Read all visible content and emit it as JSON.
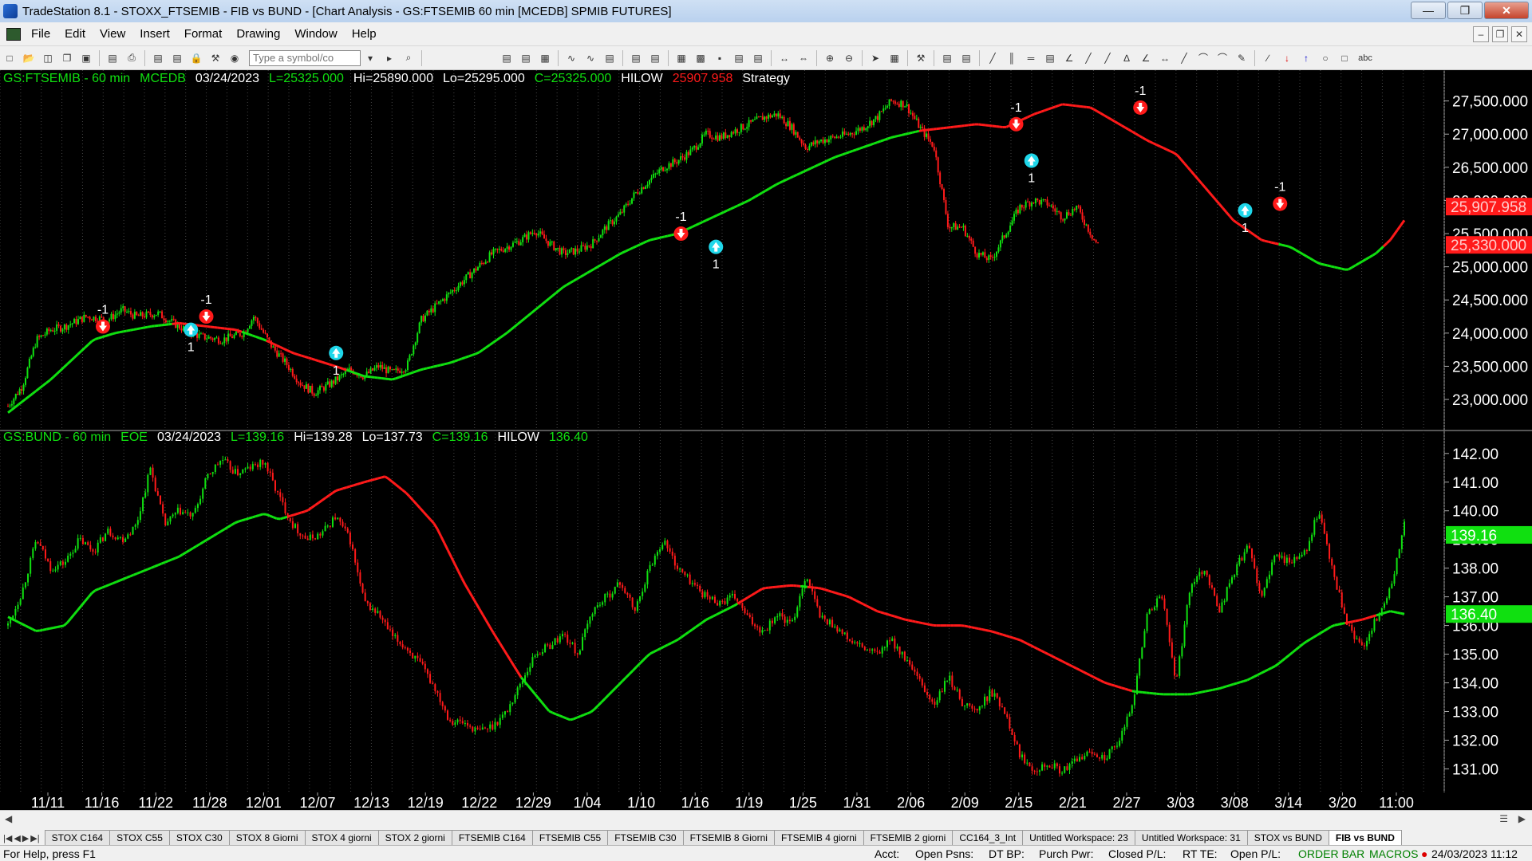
{
  "window": {
    "title": "TradeStation 8.1 - STOXX_FTSEMIB - FIB vs BUND - [Chart Analysis - GS:FTSEMIB  60 min  [MCEDB] SPMIB FUTURES]"
  },
  "menu": [
    "File",
    "Edit",
    "View",
    "Insert",
    "Format",
    "Drawing",
    "Window",
    "Help"
  ],
  "toolbar": {
    "symbol_placeholder": "Type a symbol/co"
  },
  "chart_data": [
    {
      "type": "candlestick",
      "header": {
        "symbol": "GS:FTSEMIB - 60 min",
        "source": "MCEDB",
        "date": "03/24/2023",
        "last": "L=25325.000",
        "high": "Hi=25890.000",
        "low": "Lo=25295.000",
        "close": "C=25325.000",
        "indicator": "HILOW",
        "indicator_value": "25907.958",
        "strategy": "Strategy"
      },
      "ylim": [
        22700,
        27700
      ],
      "y_ticks": [
        "27,500.000",
        "27,000.000",
        "26,500.000",
        "26,000.000",
        "25,500.000",
        "25,000.000",
        "24,500.000",
        "24,000.000",
        "23,500.000",
        "23,000.000"
      ],
      "y_tick_values": [
        27500,
        27000,
        26500,
        26000,
        25500,
        25000,
        24500,
        24000,
        23500,
        23000
      ],
      "price_markers": [
        {
          "label": "25,907.958",
          "value": 25908,
          "color": "#ff1a1a"
        },
        {
          "label": "25,330.000",
          "value": 25330,
          "color": "#ff1a1a"
        }
      ],
      "price_anchors": [
        [
          0,
          22900
        ],
        [
          20,
          23200
        ],
        [
          40,
          23900
        ],
        [
          60,
          24050
        ],
        [
          80,
          24100
        ],
        [
          110,
          24250
        ],
        [
          140,
          24200
        ],
        [
          160,
          24350
        ],
        [
          180,
          24250
        ],
        [
          210,
          24300
        ],
        [
          240,
          24100
        ],
        [
          270,
          23950
        ],
        [
          300,
          23900
        ],
        [
          330,
          24000
        ],
        [
          345,
          24250
        ],
        [
          370,
          23800
        ],
        [
          390,
          23550
        ],
        [
          410,
          23250
        ],
        [
          430,
          23100
        ],
        [
          455,
          23250
        ],
        [
          480,
          23450
        ],
        [
          500,
          23350
        ],
        [
          520,
          23500
        ],
        [
          540,
          23400
        ],
        [
          560,
          23500
        ],
        [
          580,
          24200
        ],
        [
          600,
          24400
        ],
        [
          620,
          24600
        ],
        [
          640,
          24800
        ],
        [
          660,
          25000
        ],
        [
          680,
          25200
        ],
        [
          700,
          25300
        ],
        [
          720,
          25400
        ],
        [
          740,
          25550
        ],
        [
          760,
          25350
        ],
        [
          780,
          25200
        ],
        [
          800,
          25250
        ],
        [
          820,
          25350
        ],
        [
          840,
          25600
        ],
        [
          860,
          25800
        ],
        [
          880,
          26100
        ],
        [
          900,
          26300
        ],
        [
          920,
          26500
        ],
        [
          940,
          26600
        ],
        [
          960,
          26750
        ],
        [
          980,
          27000
        ],
        [
          1000,
          26950
        ],
        [
          1020,
          27050
        ],
        [
          1040,
          27150
        ],
        [
          1060,
          27250
        ],
        [
          1080,
          27300
        ],
        [
          1100,
          27100
        ],
        [
          1120,
          26800
        ],
        [
          1140,
          26900
        ],
        [
          1160,
          26950
        ],
        [
          1180,
          27000
        ],
        [
          1200,
          27100
        ],
        [
          1220,
          27250
        ],
        [
          1240,
          27500
        ],
        [
          1260,
          27450
        ],
        [
          1280,
          27100
        ],
        [
          1300,
          26800
        ],
        [
          1320,
          25600
        ],
        [
          1340,
          25600
        ],
        [
          1360,
          25200
        ],
        [
          1380,
          25100
        ],
        [
          1400,
          25500
        ],
        [
          1420,
          25900
        ],
        [
          1440,
          26000
        ],
        [
          1460,
          25950
        ],
        [
          1480,
          25750
        ],
        [
          1500,
          25900
        ],
        [
          1525,
          25400
        ],
        [
          1530,
          25330
        ]
      ],
      "hilow_anchors": [
        [
          0,
          22800
        ],
        [
          60,
          23300
        ],
        [
          120,
          23900
        ],
        [
          150,
          24000
        ],
        [
          200,
          24100
        ],
        [
          240,
          24150
        ],
        [
          280,
          24100
        ],
        [
          320,
          24050
        ],
        [
          360,
          23900
        ],
        [
          400,
          23700
        ],
        [
          430,
          23600
        ],
        [
          460,
          23500
        ],
        [
          500,
          23350
        ],
        [
          540,
          23300
        ],
        [
          580,
          23450
        ],
        [
          620,
          23550
        ],
        [
          660,
          23700
        ],
        [
          700,
          24000
        ],
        [
          740,
          24350
        ],
        [
          780,
          24700
        ],
        [
          820,
          24950
        ],
        [
          860,
          25200
        ],
        [
          900,
          25400
        ],
        [
          940,
          25500
        ],
        [
          960,
          25600
        ],
        [
          1000,
          25800
        ],
        [
          1040,
          26000
        ],
        [
          1080,
          26250
        ],
        [
          1120,
          26450
        ],
        [
          1160,
          26650
        ],
        [
          1200,
          26800
        ],
        [
          1240,
          26950
        ],
        [
          1280,
          27050
        ],
        [
          1320,
          27100
        ],
        [
          1360,
          27150
        ],
        [
          1400,
          27100
        ],
        [
          1440,
          27300
        ],
        [
          1480,
          27450
        ],
        [
          1520,
          27400
        ],
        [
          1560,
          27150
        ],
        [
          1600,
          26900
        ],
        [
          1640,
          26700
        ],
        [
          1680,
          26200
        ],
        [
          1720,
          25700
        ],
        [
          1760,
          25400
        ],
        [
          1800,
          25300
        ],
        [
          1840,
          25050
        ],
        [
          1880,
          24950
        ],
        [
          1920,
          25200
        ],
        [
          1940,
          25400
        ],
        [
          1960,
          25700
        ]
      ],
      "signals": [
        {
          "x": 0.068,
          "value": 24100,
          "dir": "short",
          "label": "-1"
        },
        {
          "x": 0.131,
          "value": 24050,
          "dir": "long",
          "label": "1"
        },
        {
          "x": 0.142,
          "value": 24250,
          "dir": "short",
          "label": "-1"
        },
        {
          "x": 0.235,
          "value": 23700,
          "dir": "long",
          "label": "1"
        },
        {
          "x": 0.482,
          "value": 25500,
          "dir": "short",
          "label": "-1"
        },
        {
          "x": 0.507,
          "value": 25300,
          "dir": "long",
          "label": "1"
        },
        {
          "x": 0.722,
          "value": 27150,
          "dir": "short",
          "label": "-1"
        },
        {
          "x": 0.733,
          "value": 26600,
          "dir": "long",
          "label": "1"
        },
        {
          "x": 0.811,
          "value": 27400,
          "dir": "short",
          "label": "-1"
        },
        {
          "x": 0.886,
          "value": 25850,
          "dir": "long",
          "label": "1"
        },
        {
          "x": 0.911,
          "value": 25950,
          "dir": "short",
          "label": "-1"
        }
      ]
    },
    {
      "type": "candlestick",
      "header": {
        "symbol": "GS:BUND - 60 min",
        "source": "EOE",
        "date": "03/24/2023",
        "last": "L=139.16",
        "high": "Hi=139.28",
        "low": "Lo=137.73",
        "close": "C=139.16",
        "indicator": "HILOW",
        "indicator_value": "136.40"
      },
      "ylim": [
        130.4,
        142.3
      ],
      "y_ticks": [
        "142.00",
        "141.00",
        "140.00",
        "139.00",
        "138.00",
        "137.00",
        "136.00",
        "135.00",
        "134.00",
        "133.00",
        "132.00",
        "131.00"
      ],
      "y_tick_values": [
        142,
        141,
        140,
        139,
        138,
        137,
        136,
        135,
        134,
        133,
        132,
        131
      ],
      "price_markers": [
        {
          "label": "139.16",
          "value": 139.16,
          "color": "#10e010"
        },
        {
          "label": "136.40",
          "value": 136.4,
          "color": "#10e010"
        }
      ],
      "price_anchors": [
        [
          0,
          136.0
        ],
        [
          20,
          137.2
        ],
        [
          40,
          139.0
        ],
        [
          60,
          138.0
        ],
        [
          80,
          138.2
        ],
        [
          100,
          139.0
        ],
        [
          120,
          138.6
        ],
        [
          140,
          139.3
        ],
        [
          160,
          139.0
        ],
        [
          180,
          139.5
        ],
        [
          200,
          141.5
        ],
        [
          220,
          139.5
        ],
        [
          240,
          140.0
        ],
        [
          260,
          139.8
        ],
        [
          280,
          141.2
        ],
        [
          300,
          141.8
        ],
        [
          320,
          141.3
        ],
        [
          340,
          141.5
        ],
        [
          360,
          141.7
        ],
        [
          380,
          140.5
        ],
        [
          400,
          139.5
        ],
        [
          420,
          139.0
        ],
        [
          440,
          139.2
        ],
        [
          460,
          139.8
        ],
        [
          480,
          139.0
        ],
        [
          500,
          136.8
        ],
        [
          520,
          136.4
        ],
        [
          540,
          135.6
        ],
        [
          560,
          135.2
        ],
        [
          580,
          134.6
        ],
        [
          600,
          133.8
        ],
        [
          620,
          132.7
        ],
        [
          640,
          132.6
        ],
        [
          660,
          132.3
        ],
        [
          680,
          132.5
        ],
        [
          700,
          133.0
        ],
        [
          720,
          134.0
        ],
        [
          740,
          135.0
        ],
        [
          760,
          135.3
        ],
        [
          780,
          135.7
        ],
        [
          800,
          135.0
        ],
        [
          820,
          136.5
        ],
        [
          840,
          137.0
        ],
        [
          860,
          137.5
        ],
        [
          880,
          136.5
        ],
        [
          900,
          138.0
        ],
        [
          920,
          139.0
        ],
        [
          940,
          138.0
        ],
        [
          960,
          137.5
        ],
        [
          980,
          137.0
        ],
        [
          1000,
          136.8
        ],
        [
          1020,
          137.0
        ],
        [
          1040,
          136.2
        ],
        [
          1060,
          135.8
        ],
        [
          1080,
          136.4
        ],
        [
          1100,
          136.0
        ],
        [
          1120,
          137.8
        ],
        [
          1140,
          136.3
        ],
        [
          1160,
          136.0
        ],
        [
          1180,
          135.5
        ],
        [
          1200,
          135.2
        ],
        [
          1220,
          135.0
        ],
        [
          1240,
          135.5
        ],
        [
          1260,
          134.8
        ],
        [
          1280,
          134.0
        ],
        [
          1300,
          133.2
        ],
        [
          1320,
          134.2
        ],
        [
          1340,
          133.3
        ],
        [
          1360,
          133.0
        ],
        [
          1380,
          133.7
        ],
        [
          1400,
          133.0
        ],
        [
          1420,
          131.5
        ],
        [
          1440,
          131.0
        ],
        [
          1460,
          131.2
        ],
        [
          1480,
          130.9
        ],
        [
          1500,
          131.3
        ],
        [
          1520,
          131.6
        ],
        [
          1540,
          131.4
        ],
        [
          1560,
          131.9
        ],
        [
          1580,
          133.5
        ],
        [
          1600,
          136.5
        ],
        [
          1620,
          137.0
        ],
        [
          1640,
          134.0
        ],
        [
          1660,
          137.5
        ],
        [
          1680,
          138.0
        ],
        [
          1700,
          136.5
        ],
        [
          1720,
          137.8
        ],
        [
          1740,
          138.8
        ],
        [
          1760,
          137.0
        ],
        [
          1780,
          138.5
        ],
        [
          1800,
          138.2
        ],
        [
          1820,
          138.5
        ],
        [
          1840,
          140.0
        ],
        [
          1860,
          137.8
        ],
        [
          1880,
          136.0
        ],
        [
          1900,
          135.2
        ],
        [
          1920,
          136.2
        ],
        [
          1940,
          137.2
        ],
        [
          1960,
          139.5
        ]
      ],
      "hilow_anchors": [
        [
          0,
          136.3
        ],
        [
          40,
          135.8
        ],
        [
          80,
          136.0
        ],
        [
          120,
          137.2
        ],
        [
          160,
          137.6
        ],
        [
          200,
          138.0
        ],
        [
          240,
          138.4
        ],
        [
          280,
          139.0
        ],
        [
          320,
          139.6
        ],
        [
          360,
          139.9
        ],
        [
          380,
          139.7
        ],
        [
          420,
          140.0
        ],
        [
          460,
          140.7
        ],
        [
          500,
          141.0
        ],
        [
          530,
          141.2
        ],
        [
          560,
          140.6
        ],
        [
          600,
          139.5
        ],
        [
          640,
          137.5
        ],
        [
          680,
          135.8
        ],
        [
          720,
          134.2
        ],
        [
          760,
          133.0
        ],
        [
          790,
          132.7
        ],
        [
          820,
          133.0
        ],
        [
          860,
          134.0
        ],
        [
          900,
          135.0
        ],
        [
          940,
          135.5
        ],
        [
          980,
          136.2
        ],
        [
          1020,
          136.7
        ],
        [
          1060,
          137.3
        ],
        [
          1100,
          137.4
        ],
        [
          1140,
          137.3
        ],
        [
          1180,
          137.0
        ],
        [
          1220,
          136.5
        ],
        [
          1260,
          136.2
        ],
        [
          1300,
          136.0
        ],
        [
          1340,
          136.0
        ],
        [
          1380,
          135.8
        ],
        [
          1420,
          135.5
        ],
        [
          1460,
          135.0
        ],
        [
          1500,
          134.5
        ],
        [
          1540,
          134.0
        ],
        [
          1580,
          133.7
        ],
        [
          1620,
          133.6
        ],
        [
          1660,
          133.6
        ],
        [
          1700,
          133.8
        ],
        [
          1740,
          134.1
        ],
        [
          1780,
          134.6
        ],
        [
          1820,
          135.4
        ],
        [
          1860,
          136.0
        ],
        [
          1900,
          136.2
        ],
        [
          1940,
          136.5
        ],
        [
          1960,
          136.4
        ]
      ]
    }
  ],
  "x_axis": {
    "labels": [
      "11/11",
      "11/16",
      "11/22",
      "11/28",
      "12/01",
      "12/07",
      "12/13",
      "12/19",
      "12/22",
      "12/29",
      "1/04",
      "1/10",
      "1/16",
      "1/19",
      "1/25",
      "1/31",
      "2/06",
      "2/09",
      "2/15",
      "2/21",
      "2/27",
      "3/03",
      "3/08",
      "3/14",
      "3/20",
      "11:00"
    ]
  },
  "workspace_tabs": [
    "STOX C164",
    "STOX C55",
    "STOX  C30",
    "STOX  8 Giorni",
    "STOX 4 giorni",
    "STOX  2 giorni",
    "FTSEMIB C164",
    "FTSEMIB C55",
    "FTSEMIB C30",
    "FTSEMIB  8 Giorni",
    "FTSEMIB  4 giorni",
    "FTSEMIB  2 giorni",
    "CC164_3_Int",
    "Untitled Workspace:  23",
    "Untitled Workspace:  31",
    "STOX vs BUND",
    "FIB vs BUND"
  ],
  "active_tab": "FIB vs BUND",
  "status": {
    "help": "For Help, press F1",
    "acct": "Acct:",
    "open_psns": "Open Psns:",
    "dt_bp": "DT BP:",
    "purch_pwr": "Purch Pwr:",
    "closed_pl": "Closed P/L:",
    "rt_te": "RT TE:",
    "open_pl": "Open P/L:",
    "order_bar": "ORDER BAR",
    "macros": "MACROS",
    "datetime": "24/03/2023 11:12"
  },
  "colors": {
    "up": "#10e010",
    "down": "#ff1a1a",
    "hilow_up": "#10e010",
    "hilow_down": "#ff1a1a",
    "header_green": "#10e010",
    "header_red": "#ff1a1a",
    "signal_long": "#1fd7ea",
    "signal_short": "#ff1a1a"
  }
}
